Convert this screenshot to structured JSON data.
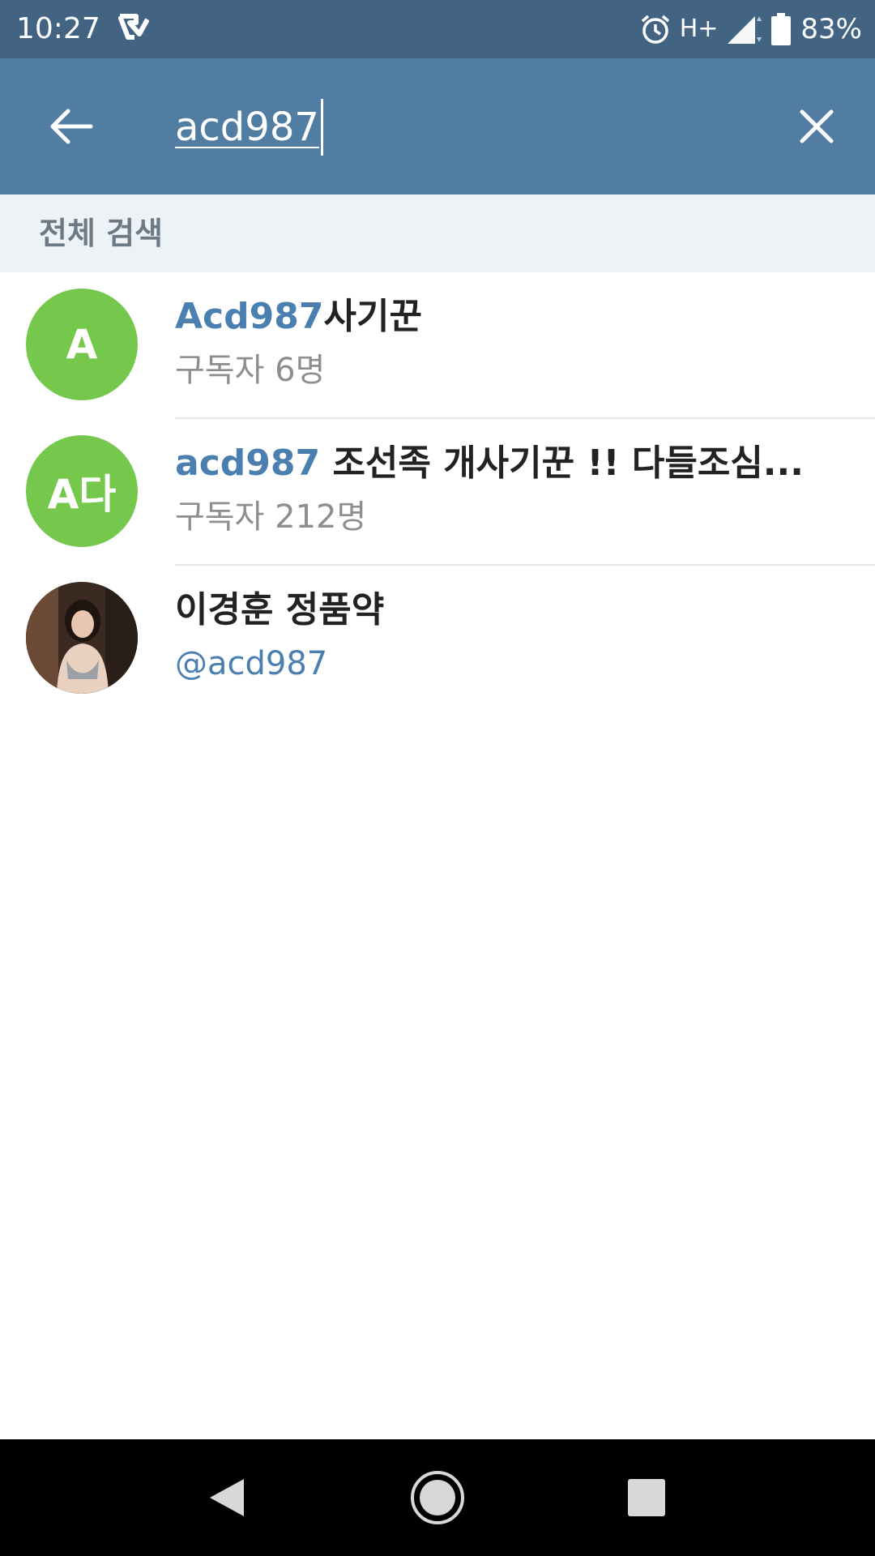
{
  "status_bar": {
    "time": "10:27",
    "network": "H+",
    "battery": "83%",
    "icons": [
      "app-check-icon",
      "alarm-icon",
      "signal-icon",
      "battery-icon"
    ]
  },
  "toolbar": {
    "query": "acd987",
    "icons": [
      "back-arrow-icon",
      "close-icon"
    ],
    "color": "#527da3"
  },
  "section": {
    "title": "전체 검색"
  },
  "results": [
    {
      "avatar_text": "A",
      "avatar_color": "#76c84d",
      "title_highlight": "Acd987",
      "title_rest": "사기꾼",
      "subtitle": "구독자 6명"
    },
    {
      "avatar_text": "A다",
      "avatar_color": "#76c84d",
      "title_highlight": "acd987",
      "title_rest": " 조선족 개사기꾼 !! 다들조심...",
      "subtitle": "구독자 212명"
    },
    {
      "avatar_text": "",
      "avatar_type": "photo",
      "title_highlight": "",
      "title_rest": "이경훈 정품약",
      "subtitle": "@acd987"
    }
  ],
  "nav_bar": {
    "icons": [
      "nav-back-icon",
      "nav-home-icon",
      "nav-recents-icon"
    ]
  }
}
